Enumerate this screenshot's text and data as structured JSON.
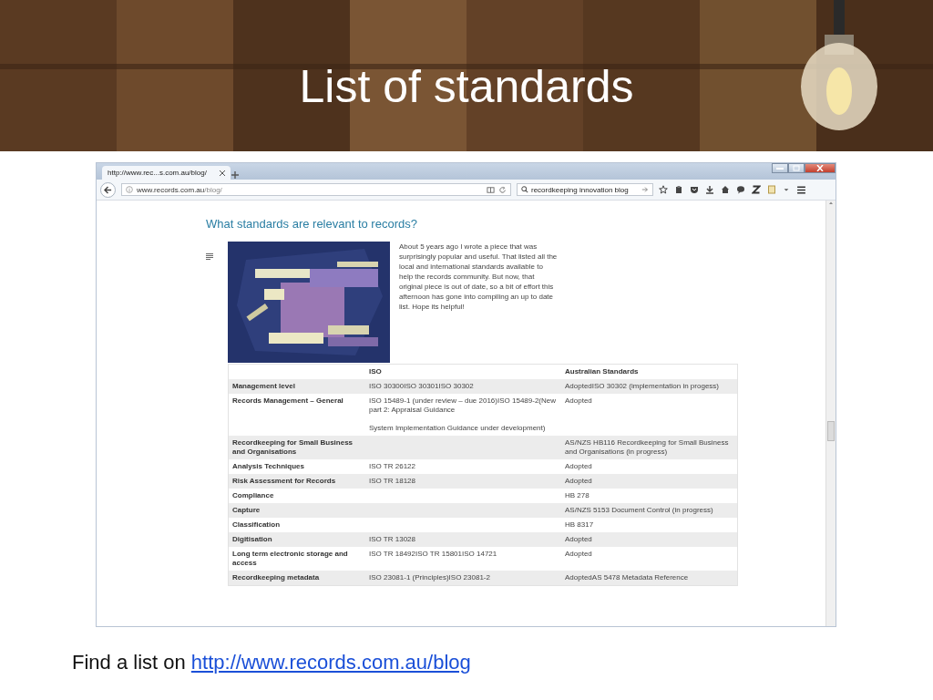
{
  "slide": {
    "title": "List of standards",
    "footer": {
      "text": "Find a list on ",
      "link": "http://www.records.com.au/blog"
    }
  },
  "browser": {
    "tabs": [
      {
        "label": "http://www.rec...s.com.au/blog/",
        "selected": true
      }
    ],
    "url": {
      "host": "www.records.com.au",
      "path": "/blog/"
    },
    "search": {
      "value": "recordkeeping innovation blog"
    }
  },
  "page": {
    "heading": "What standards are relevant to records?",
    "intro": "About 5 years ago I wrote a piece that was surprisingly popular and useful. That listed all the local and international standards available to help the records community. But now, that original piece is out of date, so a bit of effort this afternoon has gone into compiling an up to date list. Hope its helpful!",
    "table": {
      "columns": [
        "",
        "ISO",
        "Australian Standards"
      ],
      "rows": [
        [
          "Management level",
          "ISO 30300ISO 30301ISO 30302",
          "AdoptedISO 30302 (implementation in progess)"
        ],
        [
          "Records Management – General",
          "ISO 15489-1 (under review – due 2016)ISO 15489-2(New part 2: Appraisal Guidance\n\nSystem Implementation Guidance under development)",
          "Adopted"
        ],
        [
          "Recordkeeping for Small Business and Organisations",
          "",
          "AS/NZS HB116 Recordkeeping for Small Business and Organisations (in progress)"
        ],
        [
          "Analysis Techniques",
          "ISO TR 26122",
          "Adopted"
        ],
        [
          "Risk Assessment for Records",
          "ISO TR 18128",
          "Adopted"
        ],
        [
          "Compliance",
          "",
          "HB 278"
        ],
        [
          "Capture",
          "",
          "AS/NZS 5153 Document Control (in progress)"
        ],
        [
          "Classification",
          "",
          "HB 8317"
        ],
        [
          "Digitisation",
          "ISO TR 13028",
          "Adopted"
        ],
        [
          "Long term electronic storage and access",
          "ISO TR 18492ISO TR 15801ISO 14721",
          "Adopted"
        ],
        [
          "Recordkeeping metadata",
          "ISO 23081-1 (Principles)ISO 23081-2",
          "AdoptedAS 5478 Metadata Reference"
        ]
      ]
    }
  }
}
